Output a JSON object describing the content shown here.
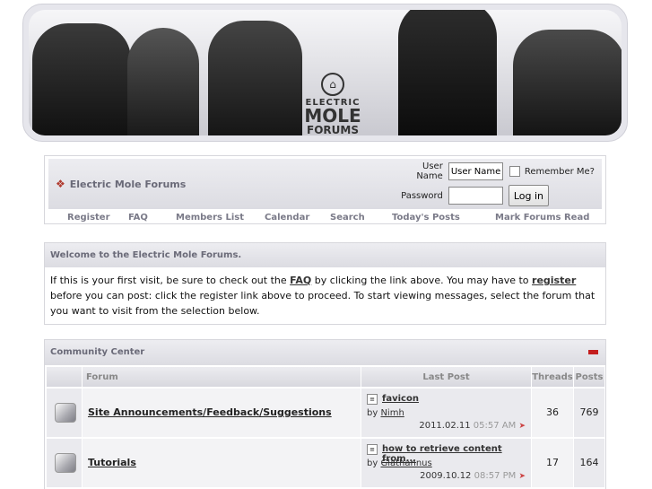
{
  "banner": {
    "logo_line1": "ELECTRIC",
    "logo_line2": "MOLE",
    "logo_line3": "FORUMS"
  },
  "navbar": {
    "title": "Electric Mole Forums",
    "username_label": "User Name",
    "username_value": "User Name",
    "remember_label": "Remember Me?",
    "password_label": "Password",
    "login_button": "Log in",
    "links": [
      "Register",
      "FAQ",
      "Members List",
      "Calendar",
      "Search",
      "Today's Posts",
      "Mark Forums Read"
    ]
  },
  "welcome": {
    "title": "Welcome to the Electric Mole Forums.",
    "text_before_faq": "If this is your first visit, be sure to check out the ",
    "faq_link": "FAQ",
    "text_after_faq": " by clicking the link above. You may have to ",
    "register_link": "register",
    "text_after_register": " before you can post: click the register link above to proceed. To start viewing messages, select the forum that you want to visit from the selection below."
  },
  "forums": {
    "category": "Community Center",
    "columns": {
      "forum": "Forum",
      "last_post": "Last Post",
      "threads": "Threads",
      "posts": "Posts"
    },
    "rows": [
      {
        "name": "Site Announcements/Feedback/Suggestions",
        "last_post_title": "favicon",
        "by_label": "by",
        "last_post_user": "Nimh",
        "last_post_date": "2011.02.11",
        "last_post_time": "05:57 AM",
        "threads": "36",
        "posts": "769"
      },
      {
        "name": "Tutorials",
        "last_post_title": "how to retrieve content from...",
        "by_label": "by",
        "last_post_user": "Glathannus",
        "last_post_date": "2009.10.12",
        "last_post_time": "08:57 PM",
        "threads": "17",
        "posts": "164"
      }
    ]
  },
  "colors": {
    "header_text": "#6a6a78",
    "collapse_icon": "#c41e1e",
    "arrow": "#cc4444"
  }
}
